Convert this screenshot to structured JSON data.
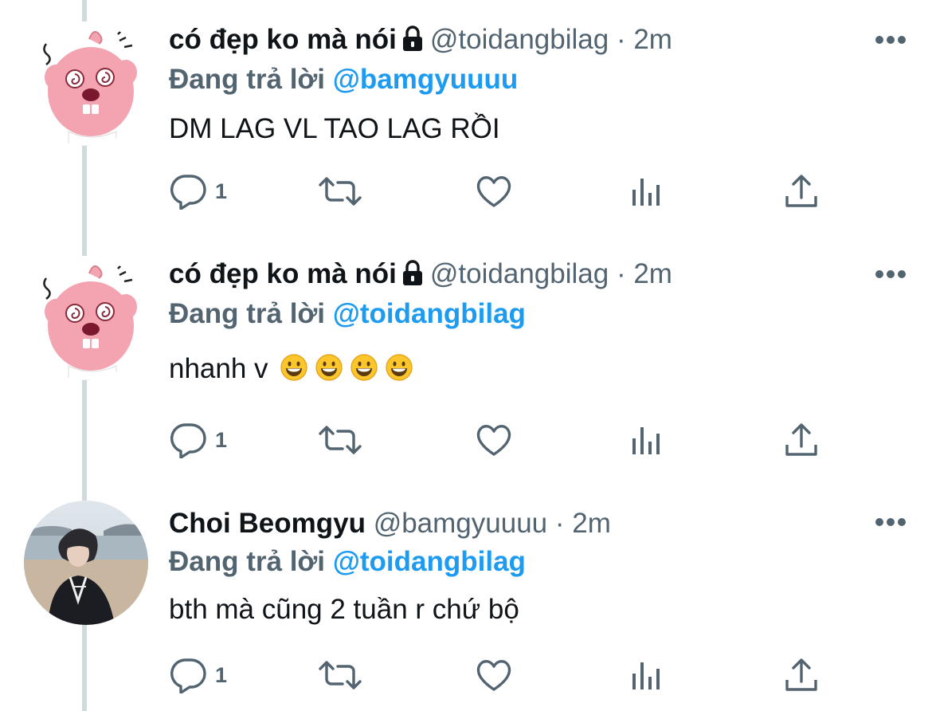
{
  "tweets": [
    {
      "name": "có đẹp ko mà nói",
      "locked": true,
      "handle": "@toidangbilag",
      "separator": "·",
      "time": "2m",
      "reply_prefix": "Đang trả lời",
      "reply_to": "@bamgyuuuu",
      "text": "DM LAG VL TAO LAG RỒI",
      "emoji_count": 0,
      "reply_count": "1",
      "avatar": "pink-beaver-avatar"
    },
    {
      "name": "có đẹp ko mà nói",
      "locked": true,
      "handle": "@toidangbilag",
      "separator": "·",
      "time": "2m",
      "reply_prefix": "Đang trả lời",
      "reply_to": "@toidangbilag",
      "text": "nhanh v",
      "emoji_count": 4,
      "emoji": "grinning-face",
      "reply_count": "1",
      "avatar": "pink-beaver-avatar"
    },
    {
      "name": "Choi Beomgyu",
      "locked": false,
      "handle": "@bamgyuuuu",
      "separator": "·",
      "time": "2m",
      "reply_prefix": "Đang trả lời",
      "reply_to": "@toidangbilag",
      "text": "bth mà cũng 2 tuần r chứ bộ",
      "emoji_count": 0,
      "reply_count": "1",
      "avatar": "beach-photo-avatar"
    }
  ],
  "icons": {
    "reply": "reply-icon",
    "retweet": "retweet-icon",
    "like": "heart-icon",
    "views": "analytics-icon",
    "share": "share-icon",
    "more": "more-icon",
    "lock": "lock-icon"
  },
  "colors": {
    "text": "#0f1419",
    "secondary": "#536471",
    "link": "#1d9bf0",
    "thread_line": "#cfd9de"
  }
}
